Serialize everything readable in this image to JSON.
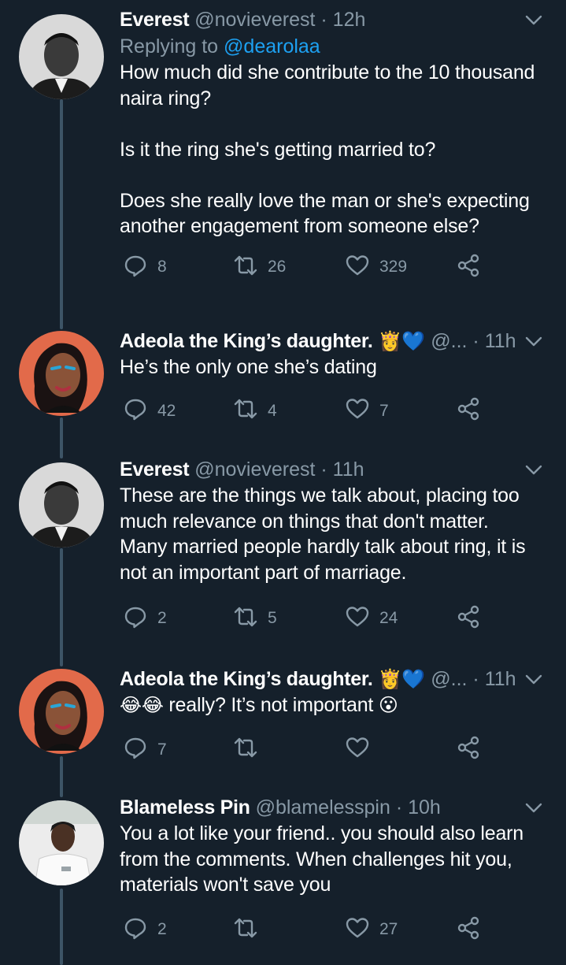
{
  "tweets": [
    {
      "name": "Everest",
      "handle": "@novieverest",
      "time": "12h",
      "replying_label": "Replying to",
      "replying_handle": "@dearolaa",
      "text": "How much did she contribute to the 10 thousand\nnaira ring?\n\nIs it the ring she's getting married to?\n\nDoes she really love the man or she's expecting\nanother engagement from someone else?",
      "replies": "8",
      "retweets": "26",
      "likes": "329"
    },
    {
      "name": "Adeola the King’s daughter.",
      "name_emojis": "👸💙",
      "handle": "@...",
      "time": "11h",
      "text": "He’s the only one she’s dating",
      "replies": "42",
      "retweets": "4",
      "likes": "7"
    },
    {
      "name": "Everest",
      "handle": "@novieverest",
      "time": "11h",
      "text": "These are the things we talk about, placing too\nmuch relevance on things that don't matter.\nMany married people hardly talk about ring, it is\nnot an important part of marriage.",
      "replies": "2",
      "retweets": "5",
      "likes": "24"
    },
    {
      "name": "Adeola the King’s daughter.",
      "name_emojis": "👸💙",
      "handle": "@...",
      "time": "11h",
      "text_emoji_before": "😂😂",
      "text": " really? It’s not important ",
      "text_emoji_after": "😮",
      "replies": "7",
      "retweets": "",
      "likes": ""
    },
    {
      "name": "Blameless Pin",
      "handle": "@blamelesspin",
      "time": "10h",
      "text": "You a lot like your friend.. you should also learn\nfrom the comments. When challenges hit you,\nmaterials won't save you",
      "replies": "2",
      "retweets": "",
      "likes": "27"
    }
  ],
  "separator": "·",
  "colors": {
    "background": "#15202b",
    "secondary_text": "#8899a6",
    "link": "#1da1f2",
    "thread_line": "#3d5466"
  },
  "icons": [
    "reply-icon",
    "retweet-icon",
    "like-icon",
    "share-icon",
    "chevron-down-icon"
  ]
}
